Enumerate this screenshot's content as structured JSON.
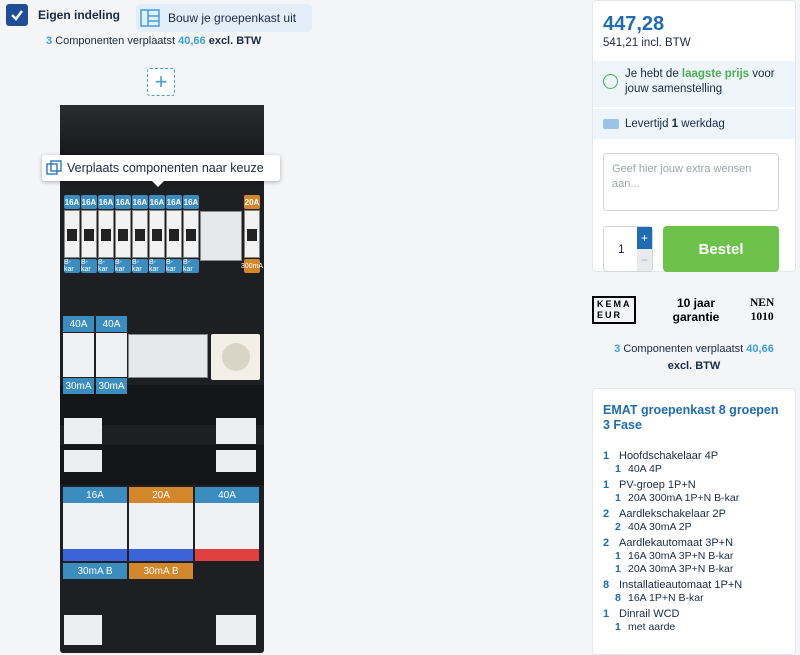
{
  "header": {
    "eigen_label": "Eigen indeling",
    "build_label": "Bouw je groepenkast uit"
  },
  "summary": {
    "count": "3",
    "mid": "Componenten verplaatst",
    "price": "40,66",
    "suffix": "excl. BTW"
  },
  "tooltip": "Verplaats componenten naar keuze",
  "breakers_row1": {
    "tags": [
      "16A",
      "16A",
      "16A",
      "16A",
      "16A",
      "16A",
      "16A",
      "16A"
    ],
    "foot": "B-kar",
    "pv_tag": "20A",
    "pv_foot": "300mA"
  },
  "rcd_row2": {
    "tags": [
      "40A",
      "40A"
    ],
    "feet": [
      "30mA",
      "30mA"
    ]
  },
  "rcd_row3": {
    "tags": [
      "16A",
      "20A",
      "40A"
    ],
    "feet": [
      "30mA B",
      "30mA B"
    ]
  },
  "price_card": {
    "price": "447,28",
    "incl": "541,21 incl. BTW",
    "lowest_pre": "Je hebt de",
    "lowest_hl": "laagste prijs",
    "lowest_post": "voor jouw samenstelling",
    "delivery_pre": "Levertijd",
    "delivery_num": "1",
    "delivery_post": "werkdag",
    "wishes_placeholder": "Geef hier jouw extra wensen aan...",
    "qty": "1",
    "order_label": "Bestel"
  },
  "badges": {
    "kema_line1": "KEMA",
    "kema_line2": "EUR",
    "garantie": "10 jaar garantie",
    "nen_line1": "NEN",
    "nen_line2": "1010"
  },
  "spec": {
    "title": "EMAT groepenkast 8 groepen 3 Fase",
    "rows": [
      {
        "n": "1",
        "t": "Hoofdschakelaar 4P",
        "sub": false
      },
      {
        "n": "1",
        "t": "40A 4P",
        "sub": true
      },
      {
        "n": "1",
        "t": "PV-groep 1P+N",
        "sub": false
      },
      {
        "n": "1",
        "t": "20A 300mA 1P+N B-kar",
        "sub": true
      },
      {
        "n": "2",
        "t": "Aardlekschakelaar 2P",
        "sub": false
      },
      {
        "n": "2",
        "t": "40A 30mA 2P",
        "sub": true
      },
      {
        "n": "2",
        "t": "Aardlekautomaat 3P+N",
        "sub": false
      },
      {
        "n": "1",
        "t": "16A 30mA 3P+N B-kar",
        "sub": true
      },
      {
        "n": "1",
        "t": "20A 30mA 3P+N B-kar",
        "sub": true
      },
      {
        "n": "8",
        "t": "Installatieautomaat 1P+N",
        "sub": false
      },
      {
        "n": "8",
        "t": "16A 1P+N B-kar",
        "sub": true
      },
      {
        "n": "1",
        "t": "Dinrail WCD",
        "sub": false
      },
      {
        "n": "1",
        "t": "met aarde",
        "sub": true
      }
    ]
  },
  "colors": {
    "accent": "#1f6bb4",
    "light_blue": "#3fa0d6",
    "green": "#6cc24a",
    "orange": "#d4862a"
  }
}
